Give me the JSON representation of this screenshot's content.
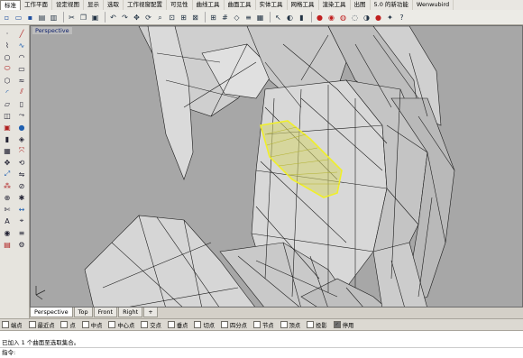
{
  "menu": {
    "items": [
      "标准",
      "工作平面",
      "设定视图",
      "显示",
      "选取",
      "工作视窗配置",
      "可见性",
      "曲线工具",
      "曲面工具",
      "实体工具",
      "网格工具",
      "渲染工具",
      "出图",
      "5.0 的新功能",
      "Wenwubird"
    ]
  },
  "toolbar": {
    "icons": [
      "new-file-icon",
      "open-icon",
      "save-icon",
      "print-icon",
      "import-icon",
      "separator",
      "cut-icon",
      "copy-icon",
      "paste-icon",
      "separator",
      "undo-icon",
      "redo-icon",
      "pan-icon",
      "rotate-view-icon",
      "zoom-icon",
      "zoom-window-icon",
      "zoom-extents-icon",
      "zoom-selected-icon",
      "separator",
      "four-views-icon",
      "grid-icon",
      "cplane-icon",
      "layers-icon",
      "properties-icon",
      "separator",
      "select-icon",
      "hide-icon",
      "lock-icon",
      "separator",
      "render-icon",
      "material-icon",
      "color-icon",
      "wireframe-icon",
      "shaded-icon",
      "sphere-icon",
      "light-icon",
      "help-icon"
    ]
  },
  "lefttools": {
    "icons": [
      "point-icon",
      "line-icon",
      "polyline-icon",
      "curve-icon",
      "circle-icon",
      "arc-icon",
      "ellipse-icon",
      "rectangle-icon",
      "polygon-icon",
      "freeform-icon",
      "fillet-icon",
      "offset-icon",
      "surface-icon",
      "extrude-icon",
      "loft-icon",
      "sweep-icon",
      "box-icon",
      "sphere-solid-icon",
      "cylinder-icon",
      "boolean-icon",
      "mesh-icon",
      "transform-icon",
      "move-icon",
      "rotate-icon",
      "scale-icon",
      "mirror-icon",
      "array-icon",
      "split-icon",
      "join-icon",
      "explode-icon",
      "trim-icon",
      "dimension-icon",
      "text-icon",
      "analyze-icon",
      "render-tool-icon",
      "layer-tool-icon",
      "properties-tool-icon",
      "options-icon"
    ]
  },
  "viewport": {
    "title": "Perspective"
  },
  "viewtabs": [
    "Perspective",
    "Top",
    "Front",
    "Right",
    "+"
  ],
  "osnap": {
    "items": [
      {
        "label": "端点",
        "checked": false
      },
      {
        "label": "最近点",
        "checked": false
      },
      {
        "label": "点",
        "checked": false
      },
      {
        "label": "中点",
        "checked": false
      },
      {
        "label": "中心点",
        "checked": false
      },
      {
        "label": "交点",
        "checked": false
      },
      {
        "label": "垂点",
        "checked": false
      },
      {
        "label": "切点",
        "checked": false
      },
      {
        "label": "四分点",
        "checked": false
      },
      {
        "label": "节点",
        "checked": false
      },
      {
        "label": "顶点",
        "checked": false
      },
      {
        "label": "投影",
        "checked": false
      },
      {
        "label": "停用",
        "checked": true
      }
    ]
  },
  "command": {
    "history": "已加入 1 个曲面至选取集合。",
    "prompt": "指令:"
  },
  "colors": {
    "viewport_bg": "#a7a7a7",
    "mesh_line": "#1a1a1a",
    "selection": "#e6e600"
  }
}
